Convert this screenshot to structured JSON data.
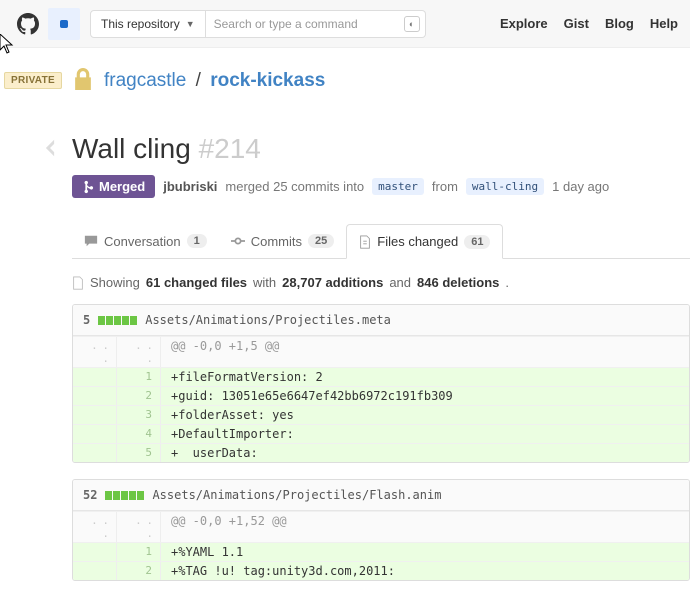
{
  "topbar": {
    "scope": "This repository",
    "searchPlaceholder": "Search or type a command",
    "nav": [
      "Explore",
      "Gist",
      "Blog",
      "Help"
    ]
  },
  "repo": {
    "privateBadge": "PRIVATE",
    "owner": "fragcastle",
    "name": "rock-kickass"
  },
  "pr": {
    "title": "Wall cling",
    "number": "#214",
    "state": "Merged",
    "author": "jbubriski",
    "mergedTextA": "merged 25 commits into",
    "baseBranch": "master",
    "mergedTextB": "from",
    "headBranch": "wall-cling",
    "time": "1 day ago"
  },
  "tabs": {
    "conversation": {
      "label": "Conversation",
      "count": "1"
    },
    "commits": {
      "label": "Commits",
      "count": "25"
    },
    "files": {
      "label": "Files changed",
      "count": "61"
    }
  },
  "summary": {
    "prefix": "Showing",
    "files": "61 changed files",
    "mid1": "with",
    "additions": "28,707 additions",
    "mid2": "and",
    "deletions": "846 deletions",
    "suffix": "."
  },
  "diffs": [
    {
      "count": "5",
      "path": "Assets/Animations/Projectiles.meta",
      "hunk": "@@ -0,0 +1,5 @@",
      "lines": [
        {
          "n": "1",
          "text": "+fileFormatVersion: 2"
        },
        {
          "n": "2",
          "text": "+guid: 13051e65e6647ef42bb6972c191fb309"
        },
        {
          "n": "3",
          "text": "+folderAsset: yes"
        },
        {
          "n": "4",
          "text": "+DefaultImporter:"
        },
        {
          "n": "5",
          "text": "+  userData:"
        }
      ]
    },
    {
      "count": "52",
      "path": "Assets/Animations/Projectiles/Flash.anim",
      "hunk": "@@ -0,0 +1,52 @@",
      "lines": [
        {
          "n": "1",
          "text": "+%YAML 1.1"
        },
        {
          "n": "2",
          "text": "+%TAG !u! tag:unity3d.com,2011:"
        }
      ]
    }
  ]
}
